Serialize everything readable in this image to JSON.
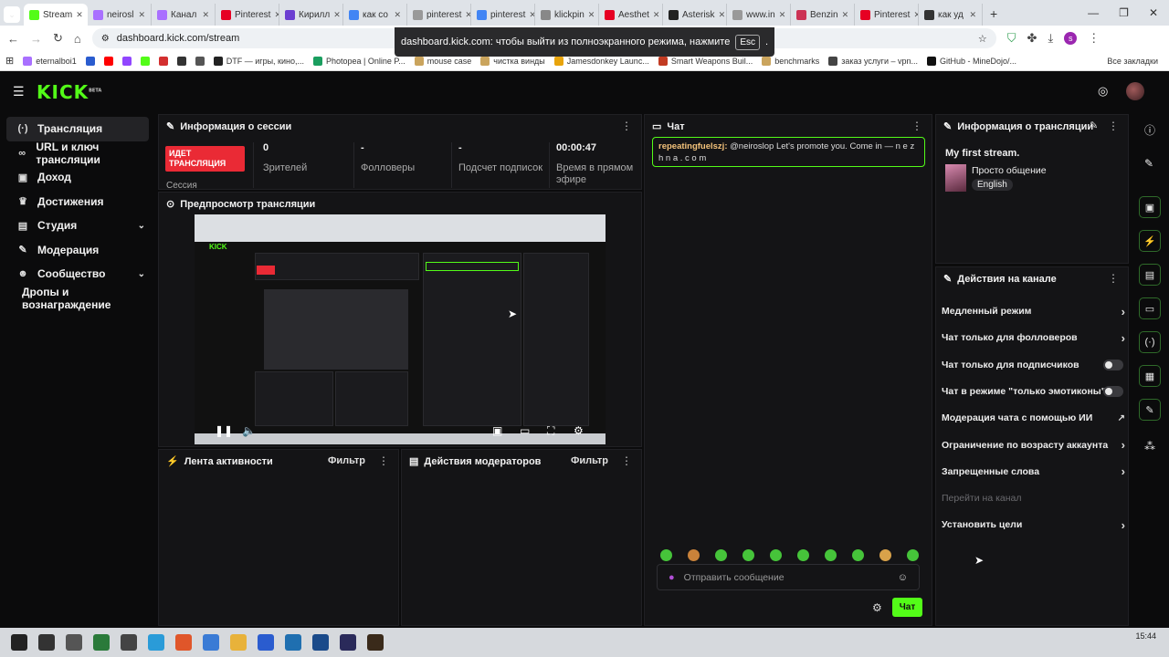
{
  "browser": {
    "tabs": [
      {
        "label": "Stream",
        "color": "#53fc18",
        "active": true
      },
      {
        "label": "neirosl",
        "color": "#a970ff"
      },
      {
        "label": "Канал",
        "color": "#a970ff"
      },
      {
        "label": "Pinterest",
        "color": "#e60023"
      },
      {
        "label": "Кирилл",
        "color": "#6c3fd1"
      },
      {
        "label": "как со",
        "color": "#4285f4"
      },
      {
        "label": "pinterest",
        "color": "#999"
      },
      {
        "label": "pinterest",
        "color": "#4285f4"
      },
      {
        "label": "klickpin",
        "color": "#888"
      },
      {
        "label": "Aesthet",
        "color": "#e60023"
      },
      {
        "label": "Asterisk",
        "color": "#222"
      },
      {
        "label": "www.in",
        "color": "#999"
      },
      {
        "label": "Benzin",
        "color": "#cc3355"
      },
      {
        "label": "Pinterest",
        "color": "#e60023"
      },
      {
        "label": "как уд",
        "color": "#333"
      }
    ],
    "url": "dashboard.kick.com/stream",
    "fullscreen_notice": "dashboard.kick.com: чтобы выйти из полноэкранного режима, нажмите",
    "fullscreen_key": "Esc",
    "bookmarks": [
      {
        "label": "eternalboi1",
        "color": "#a970ff"
      },
      {
        "label": "",
        "color": "#2a5ccf"
      },
      {
        "label": "",
        "color": "#ff0000"
      },
      {
        "label": "",
        "color": "#9146ff"
      },
      {
        "label": "",
        "color": "#53fc18"
      },
      {
        "label": "",
        "color": "#d32f2f"
      },
      {
        "label": "",
        "color": "#333"
      },
      {
        "label": "",
        "color": "#555"
      },
      {
        "label": "DTF — игры, кино,...",
        "color": "#222"
      },
      {
        "label": "Photopea | Online P...",
        "color": "#1a9e5f"
      },
      {
        "label": "mouse case",
        "color": "#caa45d"
      },
      {
        "label": "чистка винды",
        "color": "#caa45d"
      },
      {
        "label": "Jamesdonkey Launc...",
        "color": "#e8a40c"
      },
      {
        "label": "Smart Weapons Buil...",
        "color": "#c23b22"
      },
      {
        "label": "benchmarks",
        "color": "#caa45d"
      },
      {
        "label": "заказ услуги – vpn...",
        "color": "#444"
      },
      {
        "label": "GitHub - MineDojo/...",
        "color": "#111"
      }
    ],
    "all_bookmarks": "Все закладки"
  },
  "header": {
    "logo": "KICK",
    "logo_badge": "BETA"
  },
  "sidebar": {
    "items": [
      {
        "label": "Трансляция",
        "icon": "broadcast-icon",
        "glyph": "(·)",
        "active": true
      },
      {
        "label": "URL и ключ трансляции",
        "icon": "link-icon",
        "glyph": "∞"
      },
      {
        "label": "Доход",
        "icon": "money-icon",
        "glyph": "▣"
      },
      {
        "label": "Достижения",
        "icon": "trophy-icon",
        "glyph": "♛"
      },
      {
        "label": "Студия",
        "icon": "studio-icon",
        "glyph": "▤",
        "chevron": true
      },
      {
        "label": "Модерация",
        "icon": "wrench-icon",
        "glyph": "✎"
      },
      {
        "label": "Сообщество",
        "icon": "community-icon",
        "glyph": "☻",
        "chevron": true
      },
      {
        "label": "Дропы и вознаграждение",
        "icon": "",
        "glyph": "",
        "indent": true
      }
    ]
  },
  "session": {
    "title": "Информация о сессии",
    "live_badge": "ИДЕТ ТРАНСЛЯЦИЯ",
    "session_label": "Сессия",
    "stats": [
      {
        "value": "0",
        "label": "Зрителей"
      },
      {
        "value": "-",
        "label": "Фолловеры"
      },
      {
        "value": "-",
        "label": "Подсчет подписок"
      },
      {
        "value": "00:00:47",
        "label": "Время в прямом эфире"
      }
    ]
  },
  "preview": {
    "title": "Предпросмотр трансляции"
  },
  "activity": {
    "title": "Лента активности",
    "filter": "Фильтр"
  },
  "mod_actions": {
    "title": "Действия модераторов",
    "filter": "Фильтр"
  },
  "chat": {
    "title": "Чат",
    "messages": [
      {
        "user": "repeatingfuelszj:",
        "text": " @neiroslop Let's promote you. Come in — n e z h n a . c o m"
      }
    ],
    "input_placeholder": "Отправить сообщение",
    "send_label": "Чат"
  },
  "stream_info": {
    "title": "Информация о трансляции",
    "stream_title": "My first stream.",
    "category": "Просто общение",
    "language": "English"
  },
  "channel_actions": {
    "title": "Действия на канале",
    "items": [
      {
        "label": "Медленный режим",
        "control": "chevron"
      },
      {
        "label": "Чат только для фолловеров",
        "control": "chevron"
      },
      {
        "label": "Чат только для подписчиков",
        "control": "toggle"
      },
      {
        "label": "Чат в режиме \"только эмотиконы\"",
        "control": "toggle"
      },
      {
        "label": "Модерация чата с помощью ИИ",
        "control": "external"
      },
      {
        "label": "Ограничение по возрасту аккаунта",
        "control": "chevron"
      },
      {
        "label": "Запрещенные слова",
        "control": "chevron"
      },
      {
        "label": "Перейти на канал",
        "control": "disabled"
      },
      {
        "label": "Установить цели",
        "control": "chevron"
      }
    ]
  },
  "taskbar": {
    "time": "15:44"
  }
}
